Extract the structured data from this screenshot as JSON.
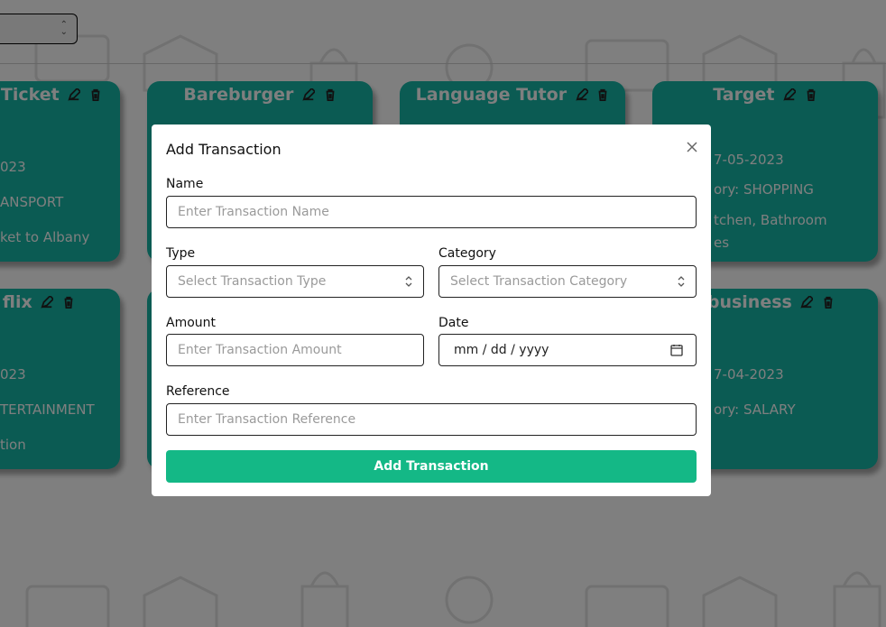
{
  "cards": [
    {
      "title": "Ticket",
      "amount": "",
      "date": "023",
      "category": "ANSPORT",
      "reference": "ket to Albany"
    },
    {
      "title": "Bareburger",
      "amount": "",
      "date": "",
      "category": "",
      "reference": ""
    },
    {
      "title": "Language Tutor",
      "amount": "",
      "date": "",
      "category": "",
      "reference": ""
    },
    {
      "title": "Target",
      "amount": "",
      "date": "7-05-2023",
      "category": "ory: SHOPPING",
      "reference": "tchen, Bathroom",
      "reference2": "es"
    },
    {
      "title": "flix",
      "amount": "",
      "date": "023",
      "category": "TERTAINMENT",
      "reference": "tion"
    },
    {
      "title": "Tbusiness",
      "amount": "",
      "date": "7-04-2023",
      "category": "ory: SALARY",
      "reference": ""
    }
  ],
  "modal": {
    "title": "Add Transaction",
    "name_label": "Name",
    "name_placeholder": "Enter Transaction Name",
    "type_label": "Type",
    "type_placeholder": "Select Transaction Type",
    "category_label": "Category",
    "category_placeholder": "Select Transaction Category",
    "amount_label": "Amount",
    "amount_placeholder": "Enter Transaction Amount",
    "date_label": "Date",
    "date_value": "mm / dd / yyyy",
    "reference_label": "Reference",
    "reference_placeholder": "Enter Transaction Reference",
    "submit_label": "Add Transaction"
  },
  "colors": {
    "card": "#17b6a6",
    "submit": "#14b886"
  },
  "icons": [
    "edit-icon",
    "delete-icon",
    "close-icon",
    "calendar-icon",
    "select-arrows-icon"
  ]
}
